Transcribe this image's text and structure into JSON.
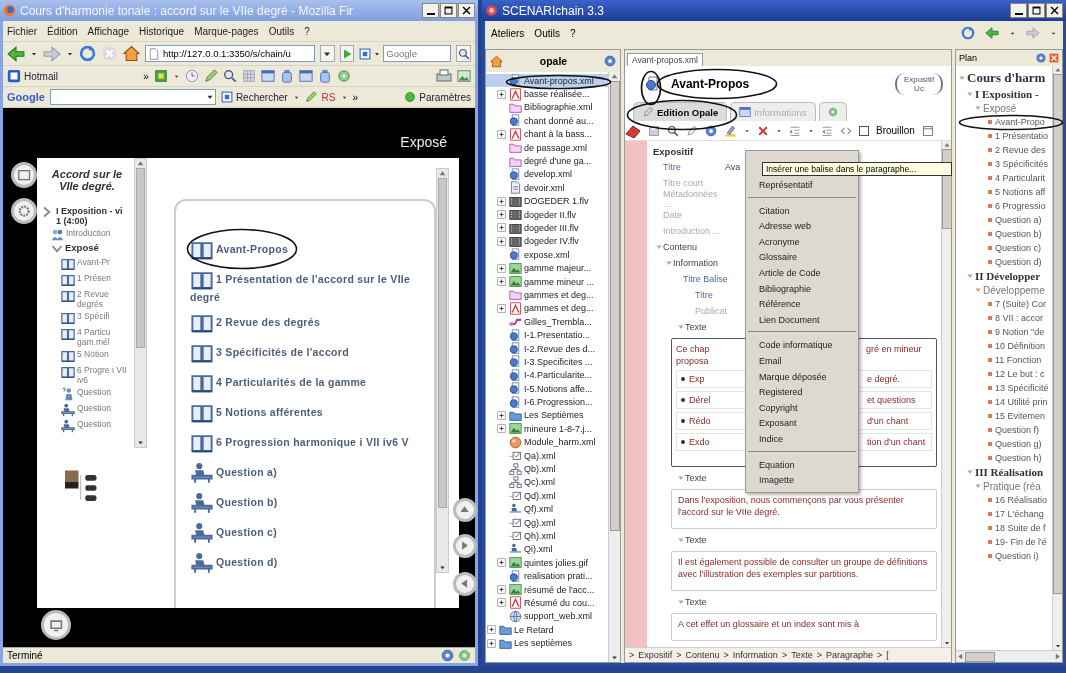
{
  "browser": {
    "title": "Cours d'harmonie tonale : accord sur le VIIe degré - Mozilla Fir",
    "menu": [
      "Fichier",
      "Édition",
      "Affichage",
      "Historique",
      "Marque-pages",
      "Outils",
      "?"
    ],
    "url": "http://127.0.0.1:3350/s/chain/u",
    "search": {
      "placeholder": "Google"
    },
    "bookmarks": [
      "Hotmail"
    ],
    "bookmarks_overflow": "»",
    "google_bar": {
      "logo": "Google",
      "search_button": "Rechercher",
      "rs_button": "RS",
      "overflow": "»",
      "settings_button": "Paramètres"
    },
    "page": {
      "header": "Exposé",
      "nav_title": "Accord sur le VIIe degré.",
      "nav": {
        "label": "I Exposition - vi",
        "duration": "1 (4:00)",
        "children": [
          {
            "kind": "intro",
            "label": "Introduction"
          },
          {
            "kind": "group",
            "label": "Exposé",
            "expanded": true,
            "children": [
              {
                "kind": "chapter",
                "label": "Avant-Pr"
              },
              {
                "kind": "chapter",
                "label": "1 Présen"
              },
              {
                "kind": "chapter",
                "label": "2 Revue degrés"
              },
              {
                "kind": "chapter",
                "label": "3 Spécifi"
              },
              {
                "kind": "chapter",
                "label": "4 Particu gam.mél"
              },
              {
                "kind": "chapter",
                "label": "5 Notion"
              },
              {
                "kind": "chapter",
                "label": "6 Progre i VII iv6"
              },
              {
                "kind": "quiz",
                "label": "Question"
              },
              {
                "kind": "exercise",
                "label": "Question"
              },
              {
                "kind": "exercise",
                "label": "Question"
              }
            ]
          }
        ]
      },
      "items": [
        {
          "kind": "chapter",
          "label": "Avant-Propos"
        },
        {
          "kind": "chapter",
          "label": "1 Présentation de l'accord sur le VIIe degré"
        },
        {
          "kind": "chapter",
          "label": "2 Revue des degrés"
        },
        {
          "kind": "chapter",
          "label": "3 Spécificités de l'accord"
        },
        {
          "kind": "chapter",
          "label": "4 Particularités de la gamme"
        },
        {
          "kind": "chapter",
          "label": "5 Notions afférentes"
        },
        {
          "kind": "chapter",
          "label": "6 Progression harmonique i VII iv6 V"
        },
        {
          "kind": "exercise",
          "label": "Question a)"
        },
        {
          "kind": "exercise",
          "label": "Question b)"
        },
        {
          "kind": "exercise",
          "label": "Question c)"
        },
        {
          "kind": "exercise",
          "label": "Question d)"
        }
      ]
    },
    "status": "Terminé"
  },
  "editor": {
    "title": "SCENARIchain 3.3",
    "menu": [
      "Ateliers",
      "Outils",
      "?"
    ],
    "workshop": "opale",
    "files": [
      {
        "name": "Avant-propos.xml",
        "kind": "unit",
        "collapsed": false,
        "selected": true
      },
      {
        "name": "basse réalisée...",
        "kind": "pdf",
        "collapsed": true,
        "selected": false
      },
      {
        "name": "Bibliographie.xml",
        "kind": "biblio",
        "collapsed": false,
        "selected": false
      },
      {
        "name": "chant donné au...",
        "kind": "unit",
        "collapsed": false,
        "selected": false
      },
      {
        "name": "chant à la bass...",
        "kind": "pdf",
        "collapsed": true,
        "selected": false
      },
      {
        "name": "de passage.xml",
        "kind": "biblio",
        "collapsed": false,
        "selected": false
      },
      {
        "name": "degré d'une ga...",
        "kind": "biblio",
        "collapsed": false,
        "selected": false
      },
      {
        "name": "develop.xml",
        "kind": "unit",
        "collapsed": false,
        "selected": false
      },
      {
        "name": "devoir.xml",
        "kind": "page",
        "collapsed": false,
        "selected": false
      },
      {
        "name": "DOGEDER 1.flv",
        "kind": "video",
        "collapsed": true,
        "selected": false
      },
      {
        "name": "dogeder II.flv",
        "kind": "video",
        "collapsed": true,
        "selected": false
      },
      {
        "name": "dogeder III.flv",
        "kind": "video",
        "collapsed": true,
        "selected": false
      },
      {
        "name": "dogeder IV.flv",
        "kind": "video",
        "collapsed": true,
        "selected": false
      },
      {
        "name": "expose.xml",
        "kind": "unit",
        "collapsed": false,
        "selected": false
      },
      {
        "name": "gamme majeur...",
        "kind": "image",
        "collapsed": true,
        "selected": false
      },
      {
        "name": "gamme mineur ...",
        "kind": "image",
        "collapsed": true,
        "selected": false
      },
      {
        "name": "gammes et deg...",
        "kind": "biblio",
        "collapsed": false,
        "selected": false
      },
      {
        "name": "gammes et deg...",
        "kind": "pdf",
        "collapsed": true,
        "selected": false
      },
      {
        "name": "Gilles_Trembla...",
        "kind": "link",
        "collapsed": false,
        "selected": false
      },
      {
        "name": "I-1.Presentatio...",
        "kind": "unit",
        "collapsed": false,
        "selected": false
      },
      {
        "name": "I-2.Revue des d...",
        "kind": "unit",
        "collapsed": false,
        "selected": false
      },
      {
        "name": "I-3.Specificites ...",
        "kind": "unit",
        "collapsed": false,
        "selected": false
      },
      {
        "name": "I-4.Particularite...",
        "kind": "unit",
        "collapsed": false,
        "selected": false
      },
      {
        "name": "I-5.Notions affe...",
        "kind": "unit",
        "collapsed": false,
        "selected": false
      },
      {
        "name": "I-6.Progression...",
        "kind": "unit",
        "collapsed": false,
        "selected": false
      },
      {
        "name": "Les Septièmes",
        "kind": "folder",
        "collapsed": true,
        "selected": false
      },
      {
        "name": "mineure 1-8-7.j...",
        "kind": "image",
        "collapsed": true,
        "selected": false
      },
      {
        "name": "Module_harm.xml",
        "kind": "module",
        "collapsed": false,
        "selected": false
      },
      {
        "name": "Qa).xml",
        "kind": "quiz",
        "collapsed": false,
        "selected": false
      },
      {
        "name": "Qb).xml",
        "kind": "order",
        "collapsed": false,
        "selected": false
      },
      {
        "name": "Qc).xml",
        "kind": "order",
        "collapsed": false,
        "selected": false
      },
      {
        "name": "Qd).xml",
        "kind": "quiz",
        "collapsed": false,
        "selected": false
      },
      {
        "name": "Qf).xml",
        "kind": "question",
        "collapsed": false,
        "selected": false
      },
      {
        "name": "Qg).xml",
        "kind": "quiz",
        "collapsed": false,
        "selected": false
      },
      {
        "name": "Qh).xml",
        "kind": "quiz",
        "collapsed": false,
        "selected": false
      },
      {
        "name": "Qi).xml",
        "kind": "question",
        "collapsed": false,
        "selected": false
      },
      {
        "name": "quintes jolies.gif",
        "kind": "image",
        "collapsed": true,
        "selected": false
      },
      {
        "name": "realisation prati...",
        "kind": "unit",
        "collapsed": false,
        "selected": false
      },
      {
        "name": "résumé de l'acc...",
        "kind": "image",
        "collapsed": true,
        "selected": false
      },
      {
        "name": "Résumé du cou...",
        "kind": "pdf",
        "collapsed": true,
        "selected": false
      },
      {
        "name": "support_web.xml",
        "kind": "web",
        "collapsed": false,
        "selected": false
      }
    ],
    "root_folders": [
      {
        "name": "Le Retard",
        "collapsed": true
      },
      {
        "name": "Les septièmes",
        "collapsed": true
      }
    ],
    "document": {
      "tab": "Avant-propos.xml",
      "title": "Avant-Propos",
      "type": "Expositif Uc",
      "tabs": [
        {
          "label": "Edition Opale",
          "selected": true
        },
        {
          "label": "Informations",
          "selected": false
        }
      ],
      "draft": {
        "label": "Brouillon",
        "checked": false
      },
      "tooltip": "Insérer une balise dans le paragraphe...",
      "menu": [
        {
          "kind": "item",
          "label": "Représentatif"
        },
        {
          "kind": "separator"
        },
        {
          "kind": "item",
          "label": "Citation"
        },
        {
          "kind": "item",
          "label": "Adresse web"
        },
        {
          "kind": "item",
          "label": "Acronyme"
        },
        {
          "kind": "item",
          "label": "Glossaire"
        },
        {
          "kind": "item",
          "label": "Article de Code"
        },
        {
          "kind": "item",
          "label": "Bibliographie"
        },
        {
          "kind": "item",
          "label": "Référence"
        },
        {
          "kind": "item",
          "label": "Lien Document"
        },
        {
          "kind": "separator"
        },
        {
          "kind": "item",
          "label": "Code informatique"
        },
        {
          "kind": "item",
          "label": "Email"
        },
        {
          "kind": "item",
          "label": "Marque déposée"
        },
        {
          "kind": "item",
          "label": "Registered"
        },
        {
          "kind": "item",
          "label": "Copyright"
        },
        {
          "kind": "item",
          "label": "Exposant"
        },
        {
          "kind": "item",
          "label": "Indice"
        },
        {
          "kind": "separator"
        },
        {
          "kind": "item",
          "label": "Equation"
        },
        {
          "kind": "item",
          "label": "Imagette"
        }
      ],
      "form": {
        "root": "Expositif",
        "fields": [
          {
            "label": "Titre",
            "value": "Ava",
            "optional": false
          },
          {
            "label": "Titre court",
            "optional": true
          },
          {
            "label": "Métadonnées ...",
            "optional": true
          },
          {
            "label": "Date",
            "optional": true
          },
          {
            "label": "Introduction ...",
            "optional": true
          }
        ],
        "content": {
          "label": "Contenu",
          "section": {
            "label": "Information",
            "title_block": {
              "label": "Titre Balise",
              "fields": [
                {
                  "label": "Titre",
                  "optional": false
                },
                {
                  "label": "Publicat",
                  "optional": true
                }
              ]
            },
            "texts": [
              {
                "label": "Texte",
                "kind": "covered",
                "intro_left": [
                  "Ce chap",
                  "proposa"
                ],
                "intro_right": [
                  "gré en mineur"
                ],
                "bullets": [
                  {
                    "left": [
                      "Exp"
                    ],
                    "right": [
                      "e degré."
                    ]
                  },
                  {
                    "left": [
                      "Dé",
                      "rel"
                    ],
                    "right": [
                      "et questions"
                    ]
                  },
                  {
                    "left": [
                      "Ré",
                      "do"
                    ],
                    "right": [
                      "d'un chant"
                    ]
                  },
                  {
                    "left": [
                      "Ex",
                      "do"
                    ],
                    "right": [
                      "tion d'un chant"
                    ]
                  }
                ]
              },
              {
                "label": "Texte",
                "kind": "paragraph",
                "text": "Dans l'exposition, nous commençons par vous présenter l'accord sur le VIIe degré."
              },
              {
                "label": "Texte",
                "kind": "paragraph",
                "text": "Il est également possible de consulter un groupe de définitions avec l'illustration des exemples sur partitions."
              },
              {
                "label": "Texte",
                "kind": "paragraph",
                "text": "A cet effet un glossaire et un index sont mis à"
              }
            ]
          }
        }
      },
      "breadcrumb": {
        "separator": ">",
        "items": [
          "Expositif",
          "Contenu",
          "Information",
          "Texte",
          "Paragraphe",
          "["
        ]
      }
    },
    "plan": {
      "title": "Plan",
      "tree": {
        "label": "Cours d'harm",
        "children": [
          {
            "label": "I Exposition -",
            "children": [
              {
                "label": "Exposé",
                "children": [
                  {
                    "label": "Avant-Propo"
                  },
                  {
                    "label": "1 Présentatio"
                  },
                  {
                    "label": "2 Revue des"
                  },
                  {
                    "label": "3 Spécificités"
                  },
                  {
                    "label": "4 Particularit"
                  },
                  {
                    "label": "5 Notions aff"
                  },
                  {
                    "label": "6 Progressio"
                  },
                  {
                    "label": "Question a)"
                  },
                  {
                    "label": "Question b)"
                  },
                  {
                    "label": "Question c)"
                  },
                  {
                    "label": "Question d)"
                  }
                ]
              }
            ]
          },
          {
            "label": "II Développer",
            "children": [
              {
                "label": "Développeme",
                "children": [
                  {
                    "label": "7 (Suite) Cor"
                  },
                  {
                    "label": "8 VII : accor"
                  },
                  {
                    "label": "9 Notion \"de"
                  },
                  {
                    "label": "10 Définition"
                  },
                  {
                    "label": "11 Fonction"
                  },
                  {
                    "label": "12 Le but : c"
                  },
                  {
                    "label": "13 Spécificité"
                  },
                  {
                    "label": "14 Utilité prin"
                  },
                  {
                    "label": "15 Evitemen"
                  },
                  {
                    "label": "Question f)"
                  },
                  {
                    "label": "Question g)"
                  },
                  {
                    "label": "Question h)"
                  }
                ]
              }
            ]
          },
          {
            "label": "III Réalisation",
            "children": [
              {
                "label": "Pratique (réa",
                "children": [
                  {
                    "label": "16 Réalisatio"
                  },
                  {
                    "label": "17 L'échang"
                  },
                  {
                    "label": "18 Suite de f"
                  },
                  {
                    "label": "19- Fin de l'é"
                  },
                  {
                    "label": "Question i)"
                  }
                ]
              }
            ]
          }
        ]
      }
    }
  }
}
